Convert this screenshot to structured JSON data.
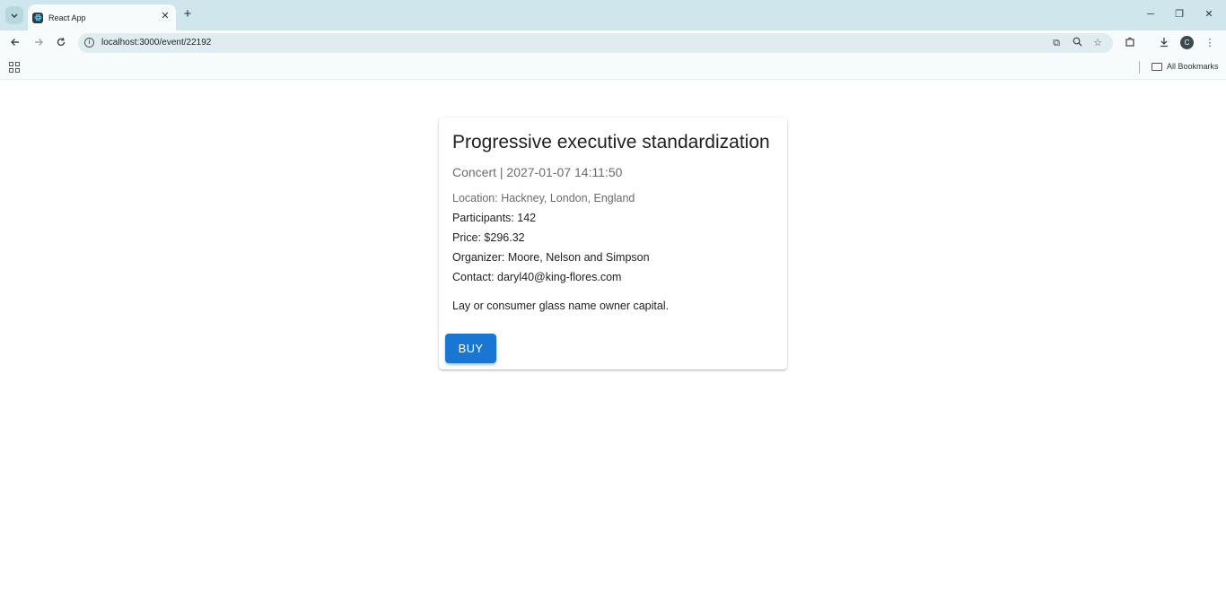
{
  "browser": {
    "tab_title": "React App",
    "url": "localhost:3000/event/22192",
    "bookmarks_label": "All Bookmarks",
    "avatar_letter": "C"
  },
  "event": {
    "title": "Progressive executive standardization",
    "subtitle": "Concert | 2027-01-07 14:11:50",
    "location": "Location: Hackney, London, England",
    "participants": "Participants: 142",
    "price": "Price: $296.32",
    "organizer": "Organizer: Moore, Nelson and Simpson",
    "contact": "Contact: daryl40@king-flores.com",
    "description": "Lay or consumer glass name owner capital.",
    "buy_label": "BUY"
  },
  "colors": {
    "buy_button": "#1976d2",
    "tabstrip": "#cfe6ec"
  }
}
